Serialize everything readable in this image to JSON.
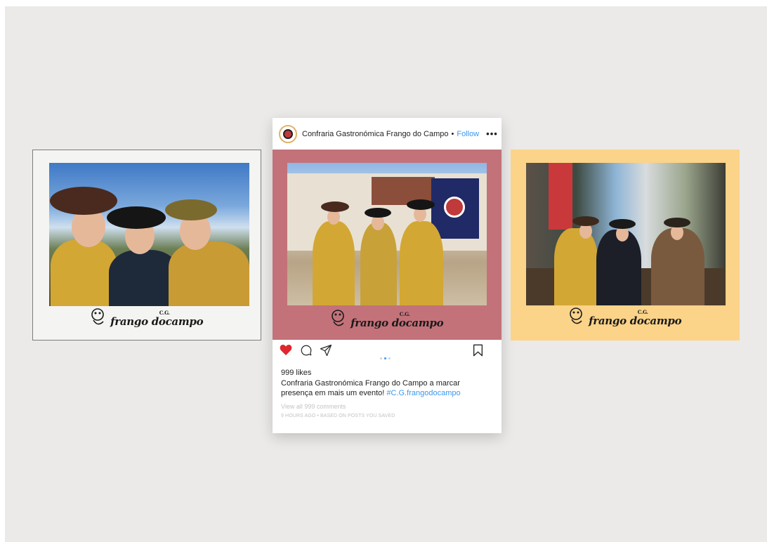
{
  "left_frame": {
    "logo_cg": "C.G.",
    "logo_name": "frango docampo"
  },
  "right_frame": {
    "logo_cg": "C.G.",
    "logo_name": "frango docampo"
  },
  "post": {
    "username": "Confraria Gastronómica Frango do Campo",
    "separator": "•",
    "follow_label": "Follow",
    "more_label": "•••",
    "media_logo_cg": "C.G.",
    "media_logo_name": "frango docampo",
    "carousel": {
      "count": 3,
      "active": 2
    },
    "likes": "999 likes",
    "caption_text": "Confraria Gastronómica Frango do Campo a marcar presença em mais um evento!",
    "hashtag": "#C.G.frangodocampo",
    "comments_link": "View all 999 comments",
    "timestamp": "9 HOURS AGO • BASED ON POSTS YOU SAVED",
    "icons": [
      "heart-icon",
      "comment-icon",
      "share-icon",
      "bookmark-icon"
    ],
    "colors": {
      "like": "#e0262e",
      "link": "#3897f0",
      "media_bg": "#c3727a"
    }
  },
  "colors": {
    "background": "#ebeae8",
    "left_frame": "#f4f4f2",
    "right_frame": "#fbd389"
  }
}
